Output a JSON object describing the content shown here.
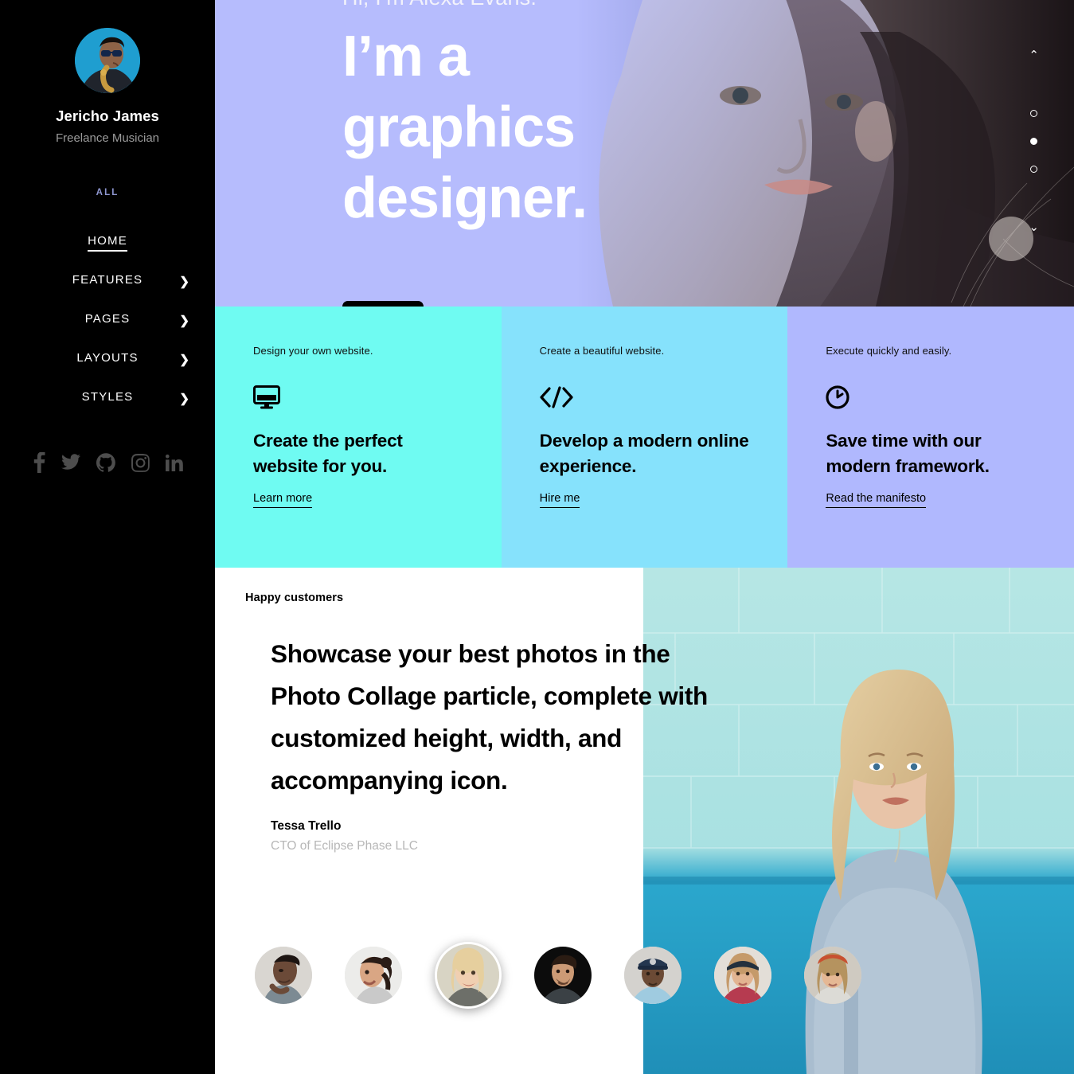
{
  "sidebar": {
    "profile": {
      "avatar_icon": "profile-photo-saxophonist",
      "name": "Jericho James",
      "role": "Freelance Musician"
    },
    "nav_label": "ALL",
    "nav_items": [
      {
        "label": "HOME",
        "has_chevron": false,
        "active": true
      },
      {
        "label": "FEATURES",
        "has_chevron": true,
        "active": false
      },
      {
        "label": "PAGES",
        "has_chevron": true,
        "active": false
      },
      {
        "label": "LAYOUTS",
        "has_chevron": true,
        "active": false
      },
      {
        "label": "STYLES",
        "has_chevron": true,
        "active": false
      }
    ],
    "chevron_glyph": "❯",
    "socials": [
      {
        "name": "facebook-icon"
      },
      {
        "name": "twitter-icon"
      },
      {
        "name": "github-icon"
      },
      {
        "name": "instagram-icon"
      },
      {
        "name": "linkedin-icon"
      }
    ]
  },
  "hero": {
    "kicker": "Hi, I’m Alexa Evans.",
    "title_line1": "I’m a",
    "title_line2": "graphics",
    "title_line3": "designer.",
    "button_label": "",
    "background_color": "#b6bcfd",
    "slider": {
      "up_glyph": "⌃",
      "down_glyph": "⌄",
      "dots": [
        {
          "active": false
        },
        {
          "active": true
        },
        {
          "active": false
        }
      ]
    }
  },
  "cards": [
    {
      "kicker": "Design your own website.",
      "icon": "desktop-monitor-icon",
      "title": "Create the perfect website for you.",
      "link": "Learn more",
      "bg": "#6ffbf2"
    },
    {
      "kicker": "Create a beautiful website.",
      "icon": "code-brackets-icon",
      "title": "Develop a modern online experience.",
      "link": "Hire me",
      "bg": "#86e2fc"
    },
    {
      "kicker": "Execute quickly and easily.",
      "icon": "clock-icon",
      "title": "Save time with our modern framework.",
      "link": "Read the manifesto",
      "bg": "#b0b8fe"
    }
  ],
  "testimonial": {
    "kicker": "Happy customers",
    "quote": "Showcase your best photos in the Photo Collage particle, complete with customized height, width, and accompanying icon.",
    "author_name": "Tessa Trello",
    "author_role": "CTO of Eclipse Phase LLC",
    "photo_icon": "woman-against-turquoise-brick-wall-photo",
    "thumbnails": [
      {
        "name": "customer-avatar-1",
        "active": false
      },
      {
        "name": "customer-avatar-2",
        "active": false
      },
      {
        "name": "customer-avatar-3",
        "active": true
      },
      {
        "name": "customer-avatar-4",
        "active": false
      },
      {
        "name": "customer-avatar-5",
        "active": false
      },
      {
        "name": "customer-avatar-6",
        "active": false
      },
      {
        "name": "customer-avatar-7",
        "active": false
      }
    ]
  }
}
